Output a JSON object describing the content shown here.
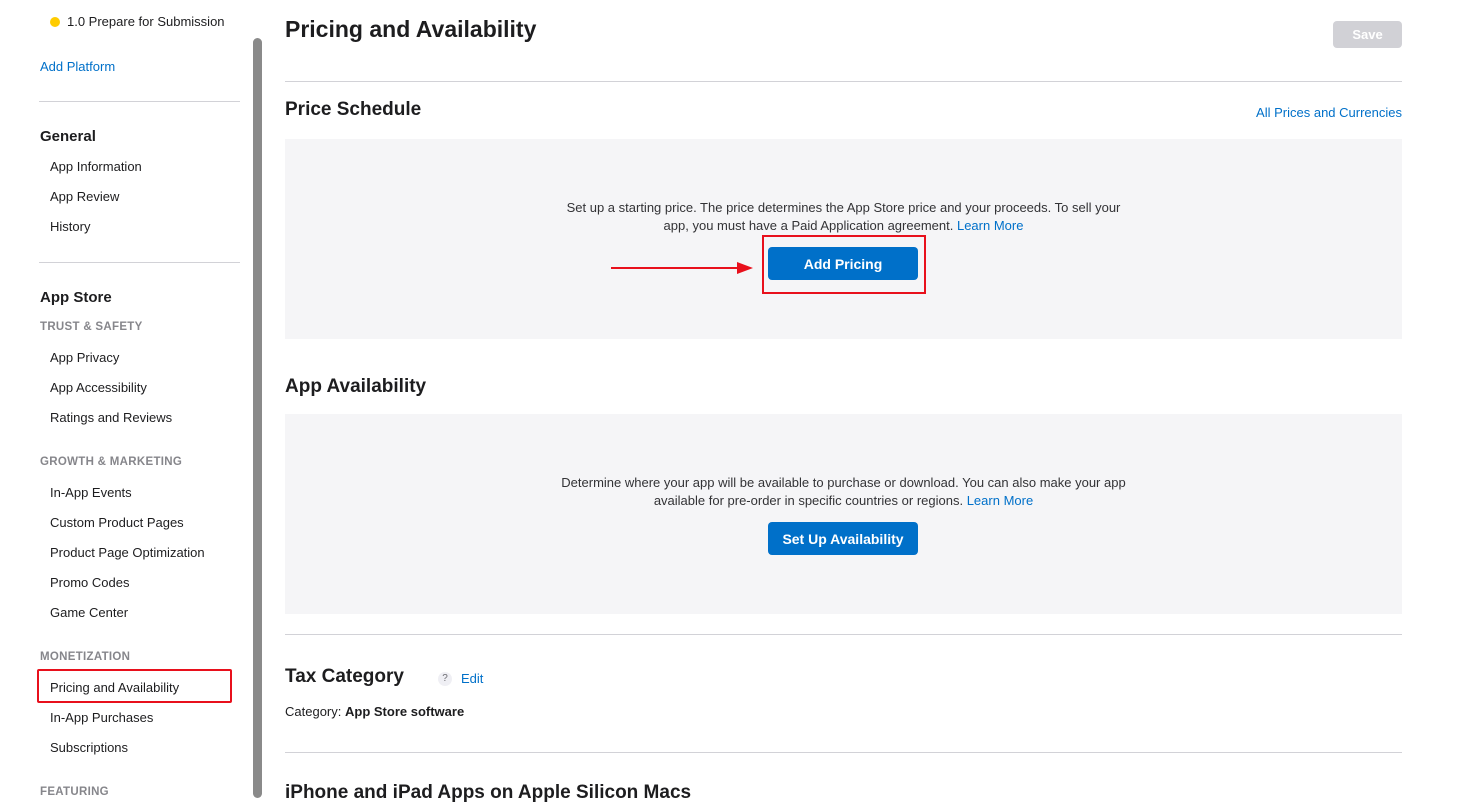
{
  "sidebar": {
    "prev_item": "1.0 Prepare for Submission",
    "add_platform": "Add Platform",
    "general": {
      "title": "General",
      "items": [
        "App Information",
        "App Review",
        "History"
      ]
    },
    "app_store": {
      "title": "App Store",
      "trust_safety": {
        "heading": "TRUST & SAFETY",
        "items": [
          "App Privacy",
          "App Accessibility",
          "Ratings and Reviews"
        ]
      },
      "growth_marketing": {
        "heading": "GROWTH & MARKETING",
        "items": [
          "In-App Events",
          "Custom Product Pages",
          "Product Page Optimization",
          "Promo Codes",
          "Game Center"
        ]
      },
      "monetization": {
        "heading": "MONETIZATION",
        "items": [
          "Pricing and Availability",
          "In-App Purchases",
          "Subscriptions"
        ],
        "active": "Pricing and Availability"
      },
      "featuring": {
        "heading": "FEATURING"
      }
    }
  },
  "main": {
    "title": "Pricing and Availability",
    "save_label": "Save",
    "price_schedule": {
      "title": "Price Schedule",
      "all_prices_link": "All Prices and Currencies",
      "text_line1": "Set up a starting price. The price determines the App Store price and your proceeds. To sell your",
      "text_line2": "app, you must have a Paid Application agreement.",
      "learn_more": "Learn More",
      "button": "Add Pricing"
    },
    "app_availability": {
      "title": "App Availability",
      "text_line1": "Determine where your app will be available to purchase or download. You can also make your app",
      "text_line2": "available for pre-order in specific countries or regions.",
      "learn_more": "Learn More",
      "button": "Set Up Availability"
    },
    "tax_category": {
      "title": "Tax Category",
      "help": "?",
      "edit": "Edit",
      "category_label": "Category:",
      "category_value": "App Store software"
    },
    "apple_silicon": {
      "title": "iPhone and iPad Apps on Apple Silicon Macs"
    }
  },
  "colors": {
    "accent": "#0070c9",
    "annotation_red": "#e8101c",
    "status_dot": "#ffcc00",
    "panel_bg": "#f5f5f7"
  }
}
